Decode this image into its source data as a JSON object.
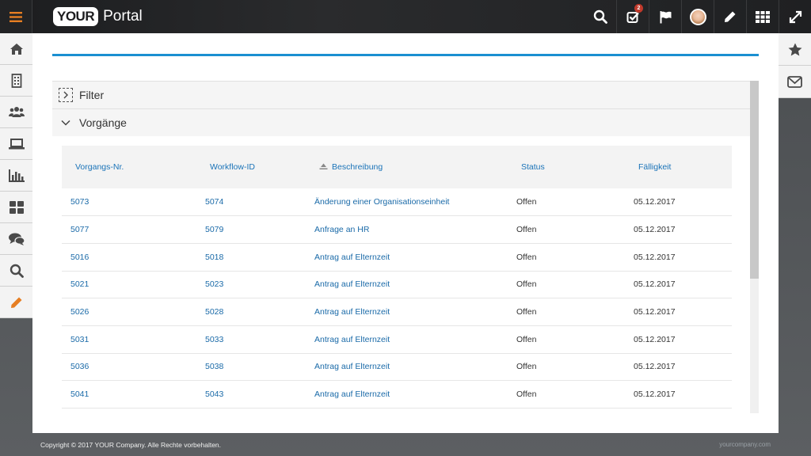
{
  "header": {
    "logo_box": "YOUR",
    "logo_text": "Portal",
    "notification_count": "2"
  },
  "sidebar": {
    "items": [
      "home-icon",
      "building-icon",
      "users-icon",
      "laptop-icon",
      "chart-icon",
      "dashboard-icon",
      "chat-icon",
      "search-icon",
      "pencil-icon"
    ]
  },
  "right_sidebar": {
    "items": [
      "star-icon",
      "mail-icon"
    ]
  },
  "accordion": {
    "filter_label": "Filter",
    "vorgaenge_label": "Vorgänge"
  },
  "table": {
    "columns": [
      "Vorgangs-Nr.",
      "Workflow-ID",
      "Beschreibung",
      "Status",
      "Fälligkeit"
    ],
    "rows": [
      [
        "5073",
        "5074",
        "Änderung einer Organisationseinheit",
        "Offen",
        "05.12.2017"
      ],
      [
        "5077",
        "5079",
        "Anfrage an HR",
        "Offen",
        "05.12.2017"
      ],
      [
        "5016",
        "5018",
        "Antrag auf Elternzeit",
        "Offen",
        "05.12.2017"
      ],
      [
        "5021",
        "5023",
        "Antrag auf Elternzeit",
        "Offen",
        "05.12.2017"
      ],
      [
        "5026",
        "5028",
        "Antrag auf Elternzeit",
        "Offen",
        "05.12.2017"
      ],
      [
        "5031",
        "5033",
        "Antrag auf Elternzeit",
        "Offen",
        "05.12.2017"
      ],
      [
        "5036",
        "5038",
        "Antrag auf Elternzeit",
        "Offen",
        "05.12.2017"
      ],
      [
        "5041",
        "5043",
        "Antrag auf Elternzeit",
        "Offen",
        "05.12.2017"
      ]
    ]
  },
  "footer": {
    "copyright": "Copyright © 2017 YOUR Company. Alle Rechte vorbehalten.",
    "site": "yourcompany.com"
  },
  "colors": {
    "accent": "#1b8fd1",
    "link": "#1a6aa8",
    "sidebar_icon": "#4a4a4a",
    "pencil_active": "#e67e22"
  }
}
